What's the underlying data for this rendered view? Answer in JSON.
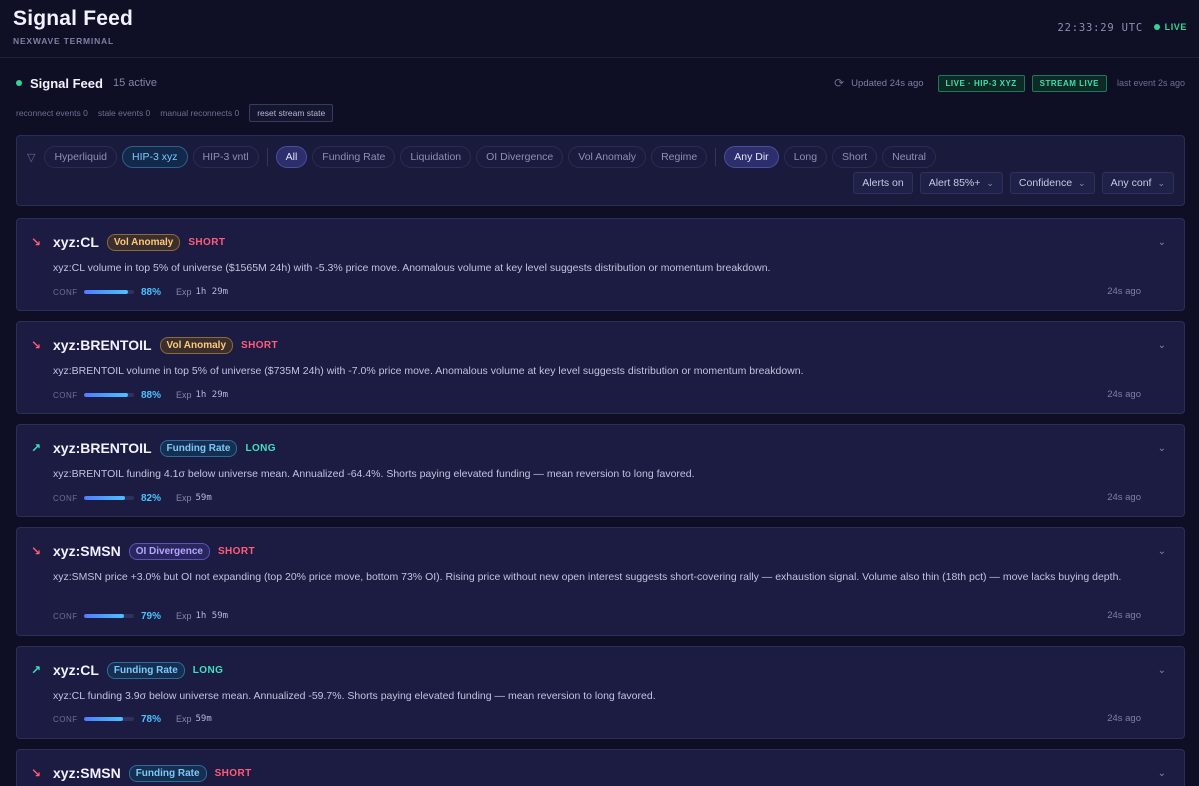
{
  "header": {
    "title": "Signal Feed",
    "subtitle": "NEXWAVE TERMINAL",
    "clock": "22:33:29 UTC",
    "live_label": "LIVE"
  },
  "feed": {
    "title": "Signal Feed",
    "count": "15 active",
    "updated": "Updated 24s ago",
    "badge_live": "LIVE · HIP-3 XYZ",
    "badge_stream": "STREAM LIVE",
    "last_event": "last event 2s ago"
  },
  "stats": {
    "reconnect": "reconnect events 0",
    "stale": "stale events 0",
    "manual": "manual reconnects 0",
    "reset_label": "reset stream state"
  },
  "filters": {
    "venues": [
      "Hyperliquid",
      "HIP-3 xyz",
      "HIP-3 vntl"
    ],
    "types": [
      "All",
      "Funding Rate",
      "Liquidation",
      "OI Divergence",
      "Vol Anomaly",
      "Regime"
    ],
    "directions": [
      "Any Dir",
      "Long",
      "Short",
      "Neutral"
    ],
    "alerts_label": "Alerts on",
    "alert_threshold": "Alert 85%+",
    "sort": "Confidence",
    "conf_filter": "Any conf"
  },
  "icons": {
    "refresh": "refresh-icon",
    "filter": "funnel-icon",
    "short": "arrow-down-right-icon",
    "long": "arrow-up-right-icon",
    "expand": "chevron-down-icon"
  },
  "colors": {
    "short": "#ff5d79",
    "long": "#3ee0c2",
    "live": "#35d39a",
    "accent": "#49c2ff"
  },
  "signals": [
    {
      "symbol": "xyz:CL",
      "type": "Vol Anomaly",
      "type_class": "vol",
      "direction": "SHORT",
      "desc": "xyz:CL volume in top 5% of universe ($1565M 24h) with -5.3% price move. Anomalous volume at key level suggests distribution or momentum breakdown.",
      "conf_label": "CONF",
      "confidence": 88,
      "conf_text": "88%",
      "exp_label": "Exp",
      "exp": "1h 29m",
      "time": "24s ago"
    },
    {
      "symbol": "xyz:BRENTOIL",
      "type": "Vol Anomaly",
      "type_class": "vol",
      "direction": "SHORT",
      "desc": "xyz:BRENTOIL volume in top 5% of universe ($735M 24h) with -7.0% price move. Anomalous volume at key level suggests distribution or momentum breakdown.",
      "conf_label": "CONF",
      "confidence": 88,
      "conf_text": "88%",
      "exp_label": "Exp",
      "exp": "1h 29m",
      "time": "24s ago"
    },
    {
      "symbol": "xyz:BRENTOIL",
      "type": "Funding Rate",
      "type_class": "fund",
      "direction": "LONG",
      "desc": "xyz:BRENTOIL funding 4.1σ below universe mean. Annualized -64.4%. Shorts paying elevated funding — mean reversion to long favored.",
      "conf_label": "CONF",
      "confidence": 82,
      "conf_text": "82%",
      "exp_label": "Exp",
      "exp": "59m",
      "time": "24s ago"
    },
    {
      "symbol": "xyz:SMSN",
      "type": "OI Divergence",
      "type_class": "oi",
      "direction": "SHORT",
      "desc": "xyz:SMSN price +3.0% but OI not expanding (top 20% price move, bottom 73% OI). Rising price without new open interest suggests short-covering rally — exhaustion signal. Volume also thin (18th pct) — move lacks buying depth.",
      "conf_label": "CONF",
      "confidence": 79,
      "conf_text": "79%",
      "exp_label": "Exp",
      "exp": "1h 59m",
      "time": "24s ago"
    },
    {
      "symbol": "xyz:CL",
      "type": "Funding Rate",
      "type_class": "fund",
      "direction": "LONG",
      "desc": "xyz:CL funding 3.9σ below universe mean. Annualized -59.7%. Shorts paying elevated funding — mean reversion to long favored.",
      "conf_label": "CONF",
      "confidence": 78,
      "conf_text": "78%",
      "exp_label": "Exp",
      "exp": "59m",
      "time": "24s ago"
    },
    {
      "symbol": "xyz:SMSN",
      "type": "Funding Rate",
      "type_class": "fund",
      "direction": "SHORT"
    }
  ]
}
